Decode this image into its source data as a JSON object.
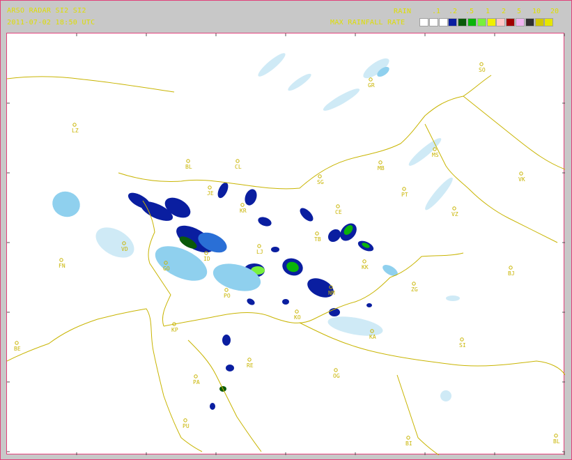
{
  "header": {
    "title": "ARSO RADAR SI2 SI2",
    "datetime": "2011-07-02 18:50 UTC",
    "rain_label": "RAIN",
    "scale_label": "MAX RAINFALL RATE"
  },
  "legend": {
    "thresholds": [
      ".1",
      ".2",
      ".5",
      "1",
      "2",
      "5",
      "10",
      "20",
      "50",
      "100"
    ],
    "colors": [
      "#ffffff",
      "#ffffff",
      "#ffffff",
      "#0a1ea0",
      "#0a5a0a",
      "#0ab40a",
      "#78f03c",
      "#f0f000",
      "#ffc8c8",
      "#a00000",
      "#f0b4f0",
      "#303030",
      "#d2c800",
      "#e6e600"
    ]
  },
  "cities": [
    {
      "code": "SO"
    },
    {
      "code": "GR"
    },
    {
      "code": "LZ"
    },
    {
      "code": "BL"
    },
    {
      "code": "CL"
    },
    {
      "code": "MS"
    },
    {
      "code": "MB"
    },
    {
      "code": "VK"
    },
    {
      "code": "SG"
    },
    {
      "code": "JE"
    },
    {
      "code": "PT"
    },
    {
      "code": "KR"
    },
    {
      "code": "CE"
    },
    {
      "code": "VZ"
    },
    {
      "code": "TB"
    },
    {
      "code": "VD"
    },
    {
      "code": "LJ"
    },
    {
      "code": "ID"
    },
    {
      "code": "FN"
    },
    {
      "code": "GO"
    },
    {
      "code": "KK"
    },
    {
      "code": "BJ"
    },
    {
      "code": "NM"
    },
    {
      "code": "ZG"
    },
    {
      "code": "PO"
    },
    {
      "code": "KP"
    },
    {
      "code": "KO"
    },
    {
      "code": "KA"
    },
    {
      "code": "SI"
    },
    {
      "code": "BE"
    },
    {
      "code": "RE"
    },
    {
      "code": "PA"
    },
    {
      "code": "OG"
    },
    {
      "code": "PU"
    },
    {
      "code": "BI"
    },
    {
      "code": "BL"
    }
  ],
  "colors": {
    "border": "#c8b400",
    "frame": "#e0407a",
    "header_text": "#dede00"
  }
}
